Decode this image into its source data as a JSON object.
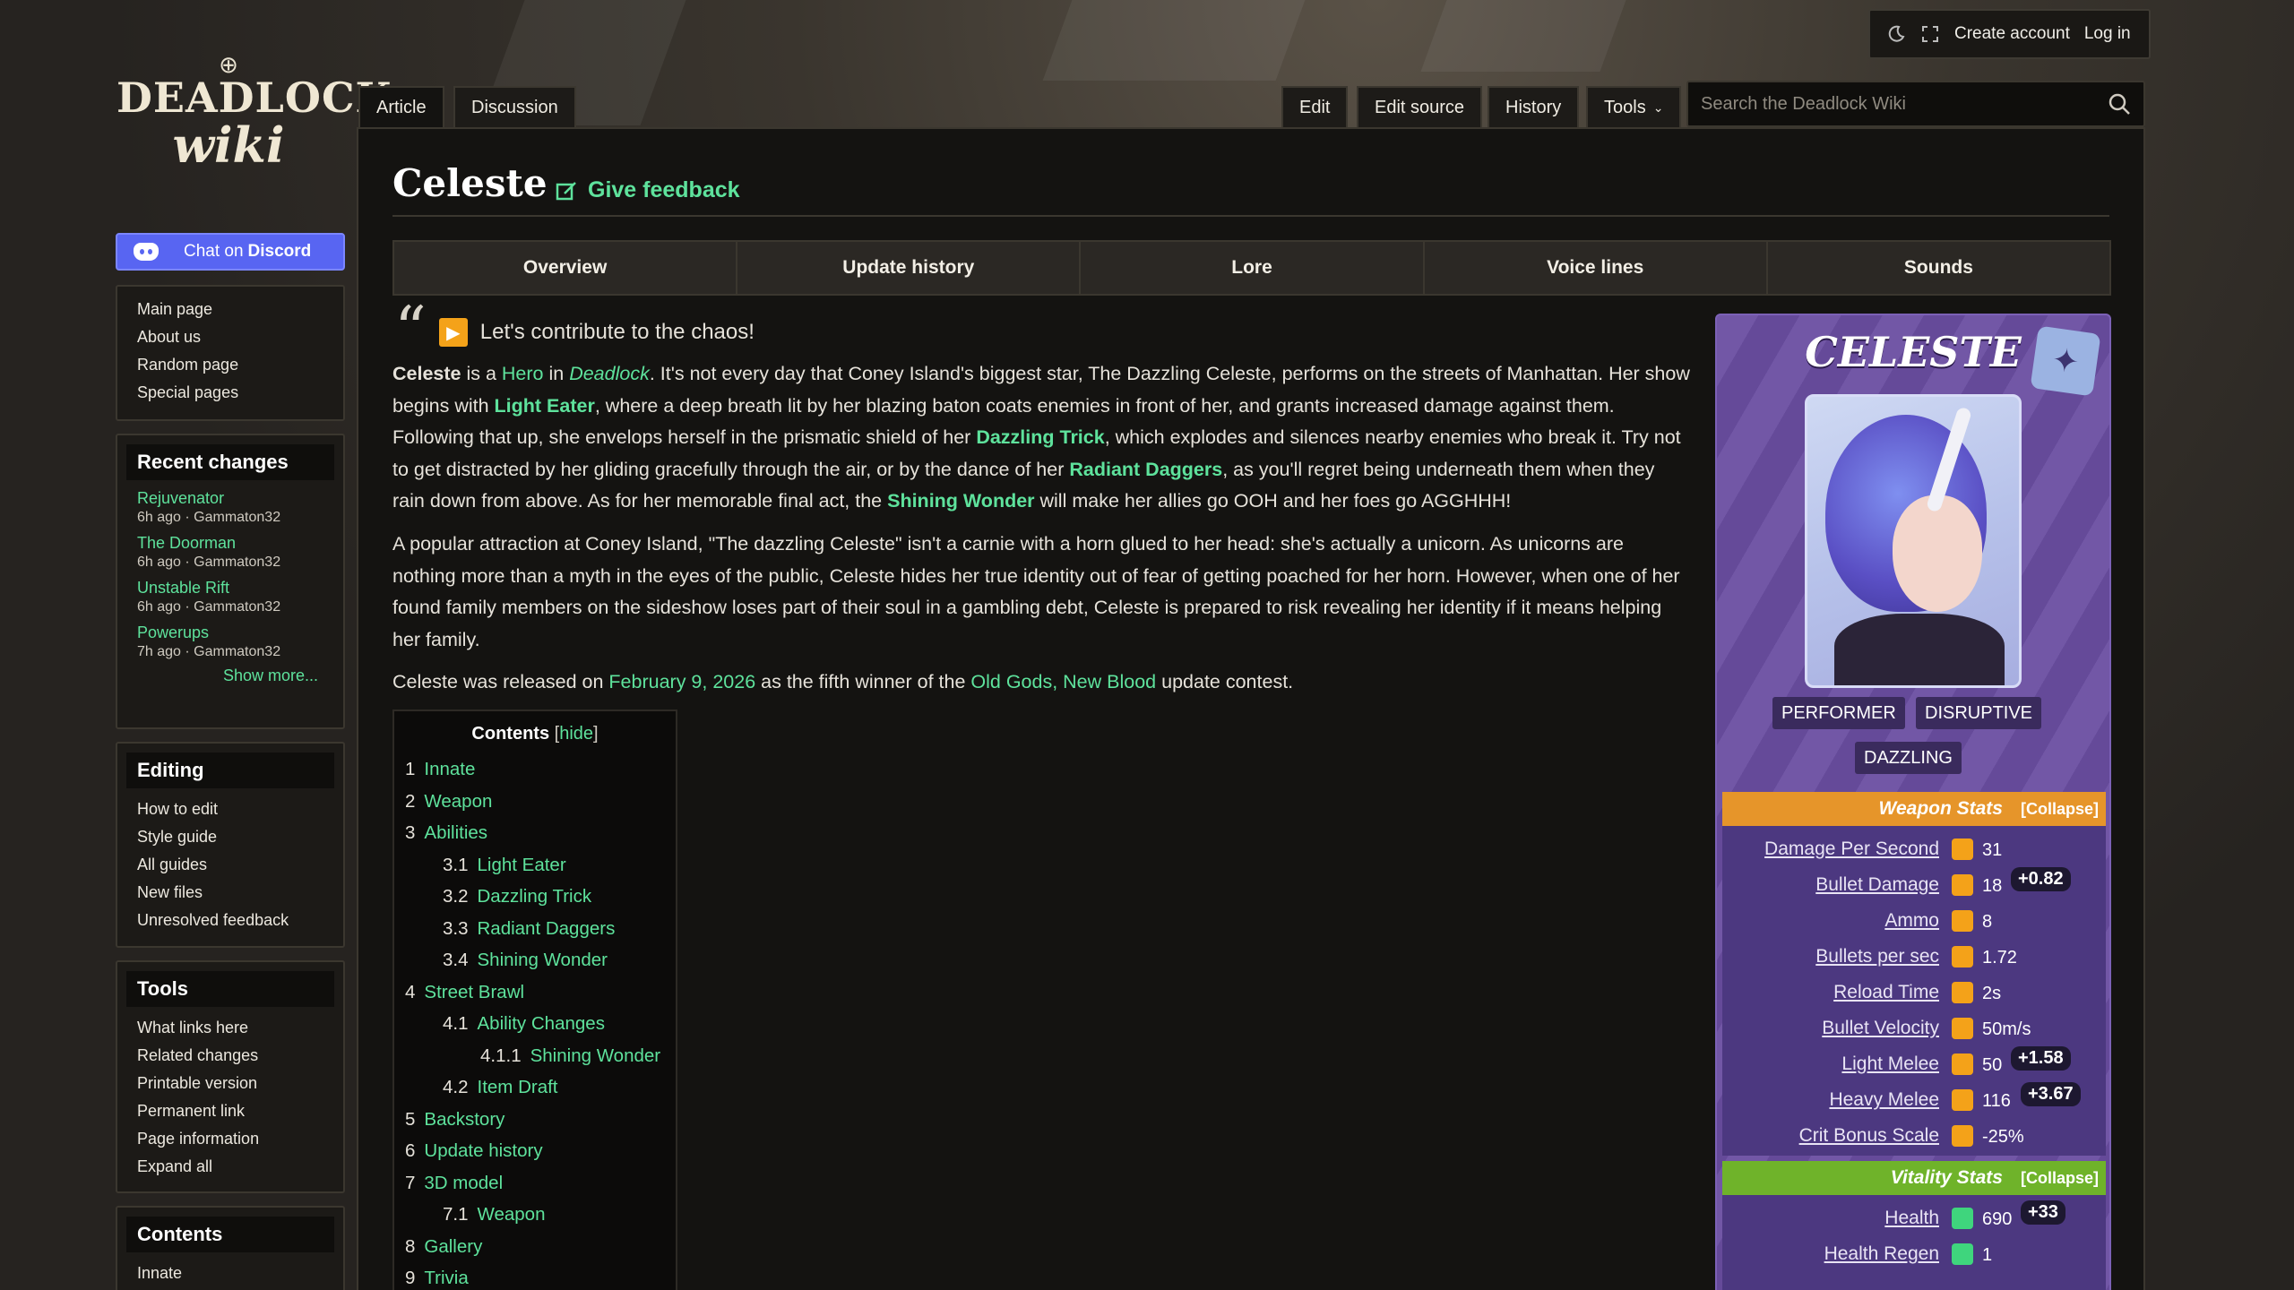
{
  "header": {
    "create_account": "Create account",
    "log_in": "Log in",
    "search_placeholder": "Search the Deadlock Wiki"
  },
  "logo": {
    "line1": "DEADLOCK",
    "line2": "wiki"
  },
  "sidebar": {
    "discord": {
      "prefix": "Chat on",
      "brand": "Discord"
    },
    "nav": [
      "Main page",
      "About us",
      "Random page",
      "Special pages"
    ],
    "recent": {
      "title": "Recent changes",
      "items": [
        {
          "title": "Rejuvenator",
          "meta": "6h ago · Gammaton32"
        },
        {
          "title": "The Doorman",
          "meta": "6h ago · Gammaton32"
        },
        {
          "title": "Unstable Rift",
          "meta": "6h ago · Gammaton32"
        },
        {
          "title": "Powerups",
          "meta": "7h ago · Gammaton32"
        }
      ],
      "show_more": "Show more..."
    },
    "editing": {
      "title": "Editing",
      "items": [
        "How to edit",
        "Style guide",
        "All guides",
        "New files",
        "Unresolved feedback"
      ]
    },
    "tools": {
      "title": "Tools",
      "items": [
        "What links here",
        "Related changes",
        "Printable version",
        "Permanent link",
        "Page information",
        "Expand all"
      ]
    },
    "contents": {
      "title": "Contents",
      "items": [
        "Innate"
      ]
    }
  },
  "tabs": {
    "article": "Article",
    "discussion": "Discussion",
    "edit": "Edit",
    "edit_source": "Edit source",
    "history": "History",
    "tools": "Tools"
  },
  "page": {
    "title": "Celeste",
    "feedback": "Give feedback",
    "subnav": [
      "Overview",
      "Update history",
      "Lore",
      "Voice lines",
      "Sounds"
    ],
    "quote": "Let's contribute to the chaos!",
    "p1": {
      "name": "Celeste",
      "t1": " is a ",
      "hero": "Hero",
      "t2": " in ",
      "game": "Deadlock",
      "t3": ". It's not every day that Coney Island's biggest star, The Dazzling Celeste, performs on the streets of Manhattan. Her show begins with ",
      "a1": "Light Eater",
      "t4": ", where a deep breath lit by her blazing baton coats enemies in front of her, and grants increased damage against them. Following that up, she envelops herself in the prismatic shield of her ",
      "a2": "Dazzling Trick",
      "t5": ", which explodes and silences nearby enemies who break it. Try not to get distracted by her gliding gracefully through the air, or by the dance of her ",
      "a3": "Radiant Daggers",
      "t6": ", as you'll regret being underneath them when they rain down from above. As for her memorable final act, the ",
      "a4": "Shining Wonder",
      "t7": " will make her allies go OOH and her foes go AGGHHH!"
    },
    "p2": "A popular attraction at Coney Island, \"The dazzling Celeste\" isn't a carnie with a horn glued to her head: she's actually a unicorn. As unicorns are nothing more than a myth in the eyes of the public, Celeste hides her true identity out of fear of getting poached for her horn. However, when one of her found family members on the sideshow loses part of their soul in a gambling debt, Celeste is prepared to risk revealing her identity if it means helping her family.",
    "p3": {
      "t1": "Celeste was released on ",
      "date": "February 9, 2026",
      "t2": " as the fifth winner of the ",
      "contest": "Old Gods, New Blood",
      "t3": " update contest."
    }
  },
  "toc": {
    "title": "Contents",
    "hide": "hide",
    "items": [
      {
        "n": "1",
        "label": "Innate",
        "level": 1
      },
      {
        "n": "2",
        "label": "Weapon",
        "level": 1
      },
      {
        "n": "3",
        "label": "Abilities",
        "level": 1
      },
      {
        "n": "3.1",
        "label": "Light Eater",
        "level": 2
      },
      {
        "n": "3.2",
        "label": "Dazzling Trick",
        "level": 2
      },
      {
        "n": "3.3",
        "label": "Radiant Daggers",
        "level": 2
      },
      {
        "n": "3.4",
        "label": "Shining Wonder",
        "level": 2
      },
      {
        "n": "4",
        "label": "Street Brawl",
        "level": 1
      },
      {
        "n": "4.1",
        "label": "Ability Changes",
        "level": 2
      },
      {
        "n": "4.1.1",
        "label": "Shining Wonder",
        "level": 3
      },
      {
        "n": "4.2",
        "label": "Item Draft",
        "level": 2
      },
      {
        "n": "5",
        "label": "Backstory",
        "level": 1
      },
      {
        "n": "6",
        "label": "Update history",
        "level": 1
      },
      {
        "n": "7",
        "label": "3D model",
        "level": 1
      },
      {
        "n": "7.1",
        "label": "Weapon",
        "level": 2
      },
      {
        "n": "8",
        "label": "Gallery",
        "level": 1
      },
      {
        "n": "9",
        "label": "Trivia",
        "level": 1
      }
    ]
  },
  "infobox": {
    "name": "CELESTE",
    "tags": [
      "PERFORMER",
      "DISRUPTIVE",
      "DAZZLING"
    ],
    "weapon": {
      "title": "Weapon Stats",
      "collapse": "[Collapse]",
      "stats": [
        {
          "k": "Damage Per Second",
          "v": "31",
          "bonus": ""
        },
        {
          "k": "Bullet Damage",
          "v": "18",
          "bonus": "+0.82"
        },
        {
          "k": "Ammo",
          "v": "8",
          "bonus": ""
        },
        {
          "k": "Bullets per sec",
          "v": "1.72",
          "bonus": ""
        },
        {
          "k": "Reload Time",
          "v": "2s",
          "bonus": ""
        },
        {
          "k": "Bullet Velocity",
          "v": "50m/s",
          "bonus": ""
        },
        {
          "k": "Light Melee",
          "v": "50",
          "bonus": "+1.58"
        },
        {
          "k": "Heavy Melee",
          "v": "116",
          "bonus": "+3.67"
        },
        {
          "k": "Crit Bonus Scale",
          "v": "-25%",
          "bonus": ""
        }
      ]
    },
    "vitality": {
      "title": "Vitality Stats",
      "collapse": "[Collapse]",
      "stats": [
        {
          "k": "Health",
          "v": "690",
          "bonus": "+33"
        },
        {
          "k": "Health Regen",
          "v": "1",
          "bonus": ""
        }
      ]
    }
  },
  "colors": {
    "accent": "#5ee29c",
    "weapon_header": "#e6952a",
    "vitality_header": "#6fb32a",
    "infobox": "#6a4ea1"
  }
}
